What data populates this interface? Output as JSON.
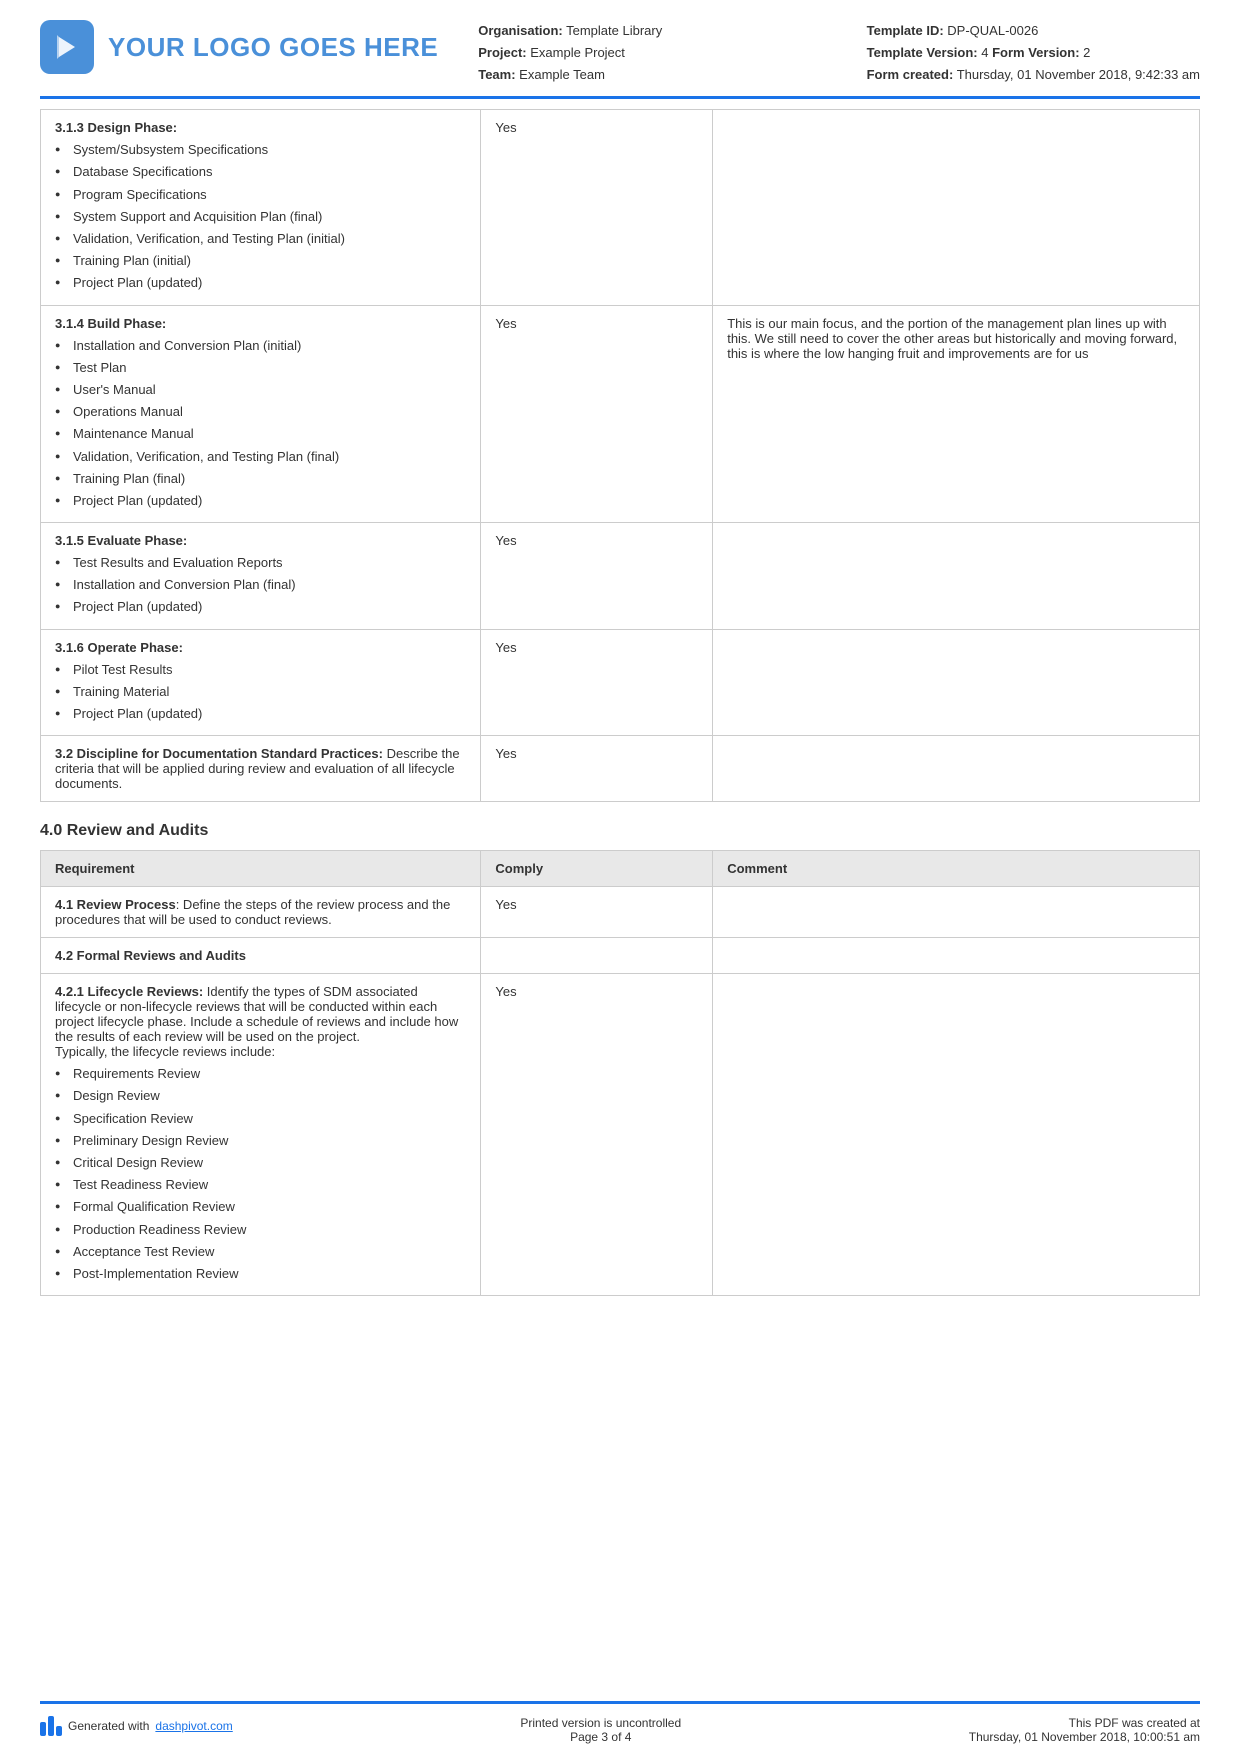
{
  "header": {
    "logo_text": "YOUR LOGO GOES HERE",
    "org_label": "Organisation:",
    "org_value": "Template Library",
    "project_label": "Project:",
    "project_value": "Example Project",
    "team_label": "Team:",
    "team_value": "Example Team",
    "template_id_label": "Template ID:",
    "template_id_value": "DP-QUAL-0026",
    "template_version_label": "Template Version:",
    "template_version_value": "4",
    "form_version_label": "Form Version:",
    "form_version_value": "2",
    "form_created_label": "Form created:",
    "form_created_value": "Thursday, 01 November 2018, 9:42:33 am"
  },
  "rows": [
    {
      "id": "row-313",
      "phase_title": "3.1.3 Design Phase:",
      "bullets": [
        "System/Subsystem Specifications",
        "Database Specifications",
        "Program Specifications",
        "System Support and Acquisition Plan (final)",
        "Validation, Verification, and Testing Plan (initial)",
        "Training Plan (initial)",
        "Project Plan (updated)"
      ],
      "comply": "Yes",
      "comment": ""
    },
    {
      "id": "row-314",
      "phase_title": "3.1.4 Build Phase:",
      "bullets": [
        "Installation and Conversion Plan (initial)",
        "Test Plan",
        "User's Manual",
        "Operations Manual",
        "Maintenance Manual",
        "Validation, Verification, and Testing Plan (final)",
        "Training Plan (final)",
        "Project Plan (updated)"
      ],
      "comply": "Yes",
      "comment": "This is our main focus, and the portion of the management plan lines up with this. We still need to cover the other areas but historically and moving forward, this is where the low hanging fruit and improvements are for us"
    },
    {
      "id": "row-315",
      "phase_title": "3.1.5 Evaluate Phase:",
      "bullets": [
        "Test Results and Evaluation Reports",
        "Installation and Conversion Plan (final)",
        "Project Plan (updated)"
      ],
      "comply": "Yes",
      "comment": ""
    },
    {
      "id": "row-316",
      "phase_title": "3.1.6 Operate Phase:",
      "bullets": [
        "Pilot Test Results",
        "Training Material",
        "Project Plan (updated)"
      ],
      "comply": "Yes",
      "comment": ""
    },
    {
      "id": "row-32",
      "phase_title": "3.2 Discipline for Documentation Standard Practices:",
      "description": "Describe the criteria that will be applied during review and evaluation of all lifecycle documents.",
      "bullets": [],
      "comply": "Yes",
      "comment": ""
    }
  ],
  "review_section": {
    "heading": "4.0 Review and Audits",
    "table_headers": {
      "col1": "Requirement",
      "col2": "Comply",
      "col3": "Comment"
    },
    "rows": [
      {
        "id": "row-41",
        "type": "normal",
        "label": "4.1 Review Process",
        "description": ": Define the steps of the review process and the procedures that will be used to conduct reviews.",
        "comply": "Yes",
        "comment": ""
      },
      {
        "id": "row-42",
        "type": "heading",
        "label": "4.2 Formal Reviews and Audits",
        "comply": "",
        "comment": ""
      },
      {
        "id": "row-421",
        "type": "list",
        "label": "4.2.1 Lifecycle Reviews:",
        "description": " Identify the types of SDM associated lifecycle or non-lifecycle reviews that will be conducted within each project lifecycle phase. Include a schedule of reviews and include how the results of each review will be used on the project.\nTypically, the lifecycle reviews include:",
        "bullets": [
          "Requirements Review",
          "Design Review",
          "Specification Review",
          "Preliminary Design Review",
          "Critical Design Review",
          "Test Readiness Review",
          "Formal Qualification Review",
          "Production Readiness Review",
          "Acceptance Test Review",
          "Post-Implementation Review"
        ],
        "comply": "Yes",
        "comment": ""
      }
    ]
  },
  "footer": {
    "generated_text": "Generated with ",
    "dashpivot_link": "dashpivot.com",
    "page_info": "Printed version is uncontrolled\nPage 3 of 4",
    "pdf_created": "This PDF was created at\nThursday, 01 November 2018, 10:00:51 am"
  }
}
